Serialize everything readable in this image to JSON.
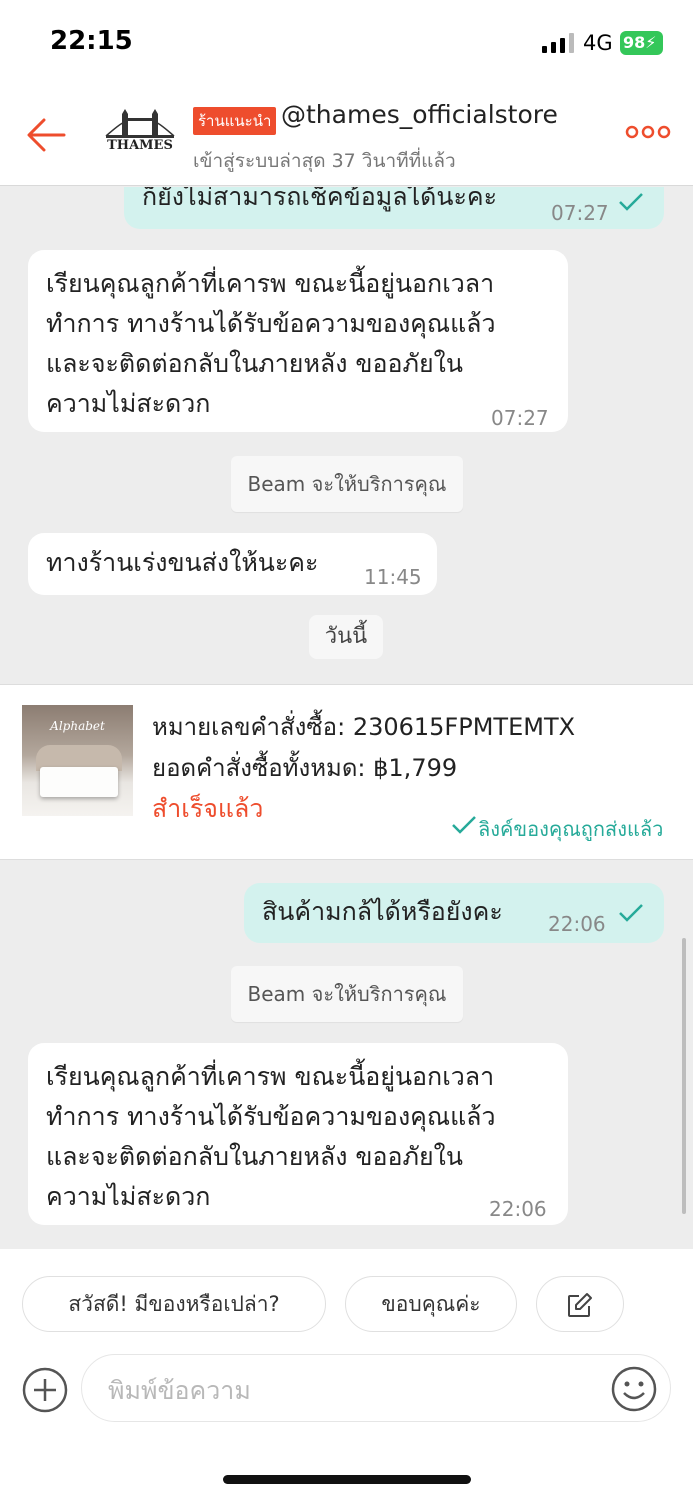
{
  "status_bar": {
    "time": "22:15",
    "network": "4G",
    "battery": "98"
  },
  "header": {
    "badge": "ร้านแนะนำ",
    "store_name": "@thames_officialstore",
    "last_seen": "เข้าสู่ระบบล่าสุด 37 วินาทีที่แล้ว",
    "logo_text": "THAMES"
  },
  "messages": [
    {
      "text": "ก็ยังไม่สามารถเช็คข้อมูลได้นะคะ",
      "time": "07:27"
    },
    {
      "lines": [
        "เรียนคุณลูกค้าที่เคารพ ขณะนี้อยู่นอกเวลา",
        "ทำการ ทางร้านได้รับข้อความของคุณแล้ว",
        "และจะติดต่อกลับในภายหลัง ขออภัยใน",
        "ความไม่สะดวก"
      ],
      "time": "07:27"
    },
    {
      "text": "Beam จะให้บริการคุณ"
    },
    {
      "text": "ทางร้านเร่งขนส่งให้นะคะ",
      "time": "11:45"
    },
    {
      "text": "วันนี้"
    },
    {
      "text": "สินค้ามกล้ได้หรือยังคะ",
      "time": "22:06"
    },
    {
      "text": "Beam จะให้บริการคุณ"
    },
    {
      "lines": [
        "เรียนคุณลูกค้าที่เคารพ ขณะนี้อยู่นอกเวลา",
        "ทำการ ทางร้านได้รับข้อความของคุณแล้ว",
        "และจะติดต่อกลับในภายหลัง ขออภัยใน",
        "ความไม่สะดวก"
      ],
      "time": "22:06"
    }
  ],
  "order": {
    "number_line": "หมายเลขคำสั่งซื้อ: 230615FPMTEMTX",
    "total_line": "ยอดคำสั่งซื้อทั้งหมด: ฿1,799",
    "status": "สำเร็จแล้ว",
    "sent_note": "ลิงค์ของคุณถูกส่งแล้ว",
    "image_title": "Alphabet"
  },
  "quick_replies": [
    "สวัสดี! มีของหรือเปล่า?",
    "ขอบคุณค่ะ"
  ],
  "composer": {
    "placeholder": "พิมพ์ข้อความ"
  },
  "colors": {
    "brand": "#ee4d2d",
    "teal": "#26aa99",
    "outgoing_bubble": "#d3f2ee"
  }
}
